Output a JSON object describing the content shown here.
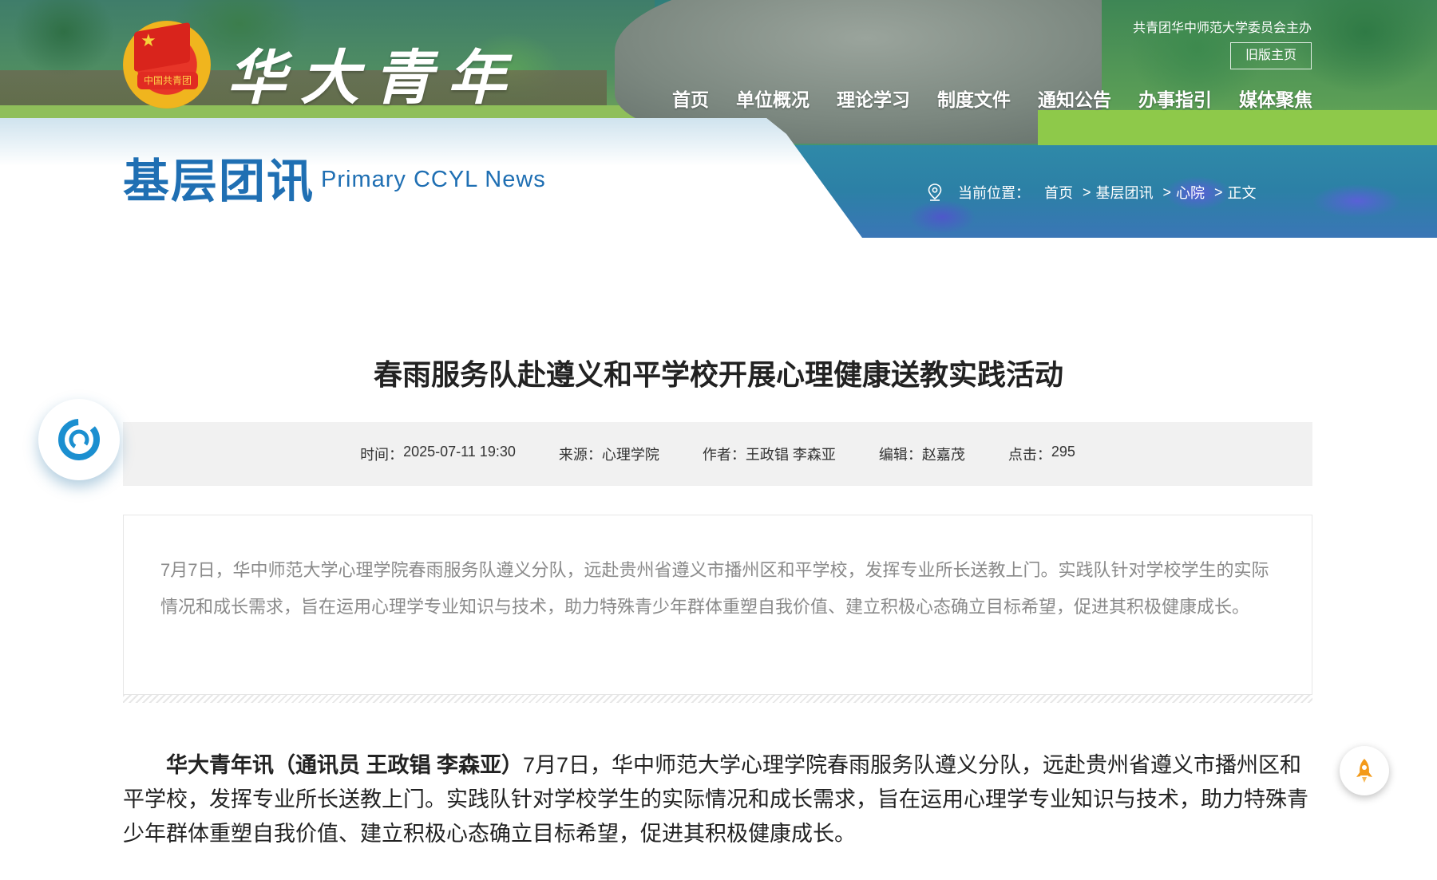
{
  "header": {
    "site_name": "华大青年",
    "host_note": "共青团华中师范大学委员会主办",
    "old_home_label": "旧版主页",
    "logo_text": "中国共青团",
    "nav": [
      "首页",
      "单位概况",
      "理论学习",
      "制度文件",
      "通知公告",
      "办事指引",
      "媒体聚焦"
    ]
  },
  "section": {
    "title": "基层团讯",
    "subtitle": "Primary CCYL News"
  },
  "breadcrumb": {
    "label": "当前位置：",
    "items": [
      "首页",
      "基层团讯",
      "心院",
      "正文"
    ]
  },
  "article": {
    "title": "春雨服务队赴遵义和平学校开展心理健康送教实践活动",
    "meta": {
      "time_label": "时间：",
      "time": "2025-07-11 19:30",
      "source_label": "来源：",
      "source": "心理学院",
      "author_label": "作者：",
      "author": "王政锠 李森亚",
      "editor_label": "编辑：",
      "editor": "赵嘉茂",
      "clicks_label": "点击：",
      "clicks": "295"
    },
    "summary": "7月7日，华中师范大学心理学院春雨服务队遵义分队，远赴贵州省遵义市播州区和平学校，发挥专业所长送教上门。实践队针对学校学生的实际情况和成长需求，旨在运用心理学专业知识与技术，助力特殊青少年群体重塑自我价值、建立积极心态确立目标希望，促进其积极健康成长。",
    "body_lead": "华大青年讯（通讯员 王政锠 李森亚）",
    "body": "7月7日，华中师范大学心理学院春雨服务队遵义分队，远赴贵州省遵义市播州区和平学校，发挥专业所长送教上门。实践队针对学校学生的实际情况和成长需求，旨在运用心理学专业知识与技术，助力特殊青少年群体重塑自我价值、建立积极心态确立目标希望，促进其积极健康成长。"
  },
  "icons": {
    "left_float": "refresh-icon",
    "right_float": "rocket-icon",
    "breadcrumb": "location-pin-icon"
  },
  "colors": {
    "brand_blue": "#1f6fb3",
    "meta_bg": "#f1f1f1",
    "rocket": "#f39a1a"
  }
}
